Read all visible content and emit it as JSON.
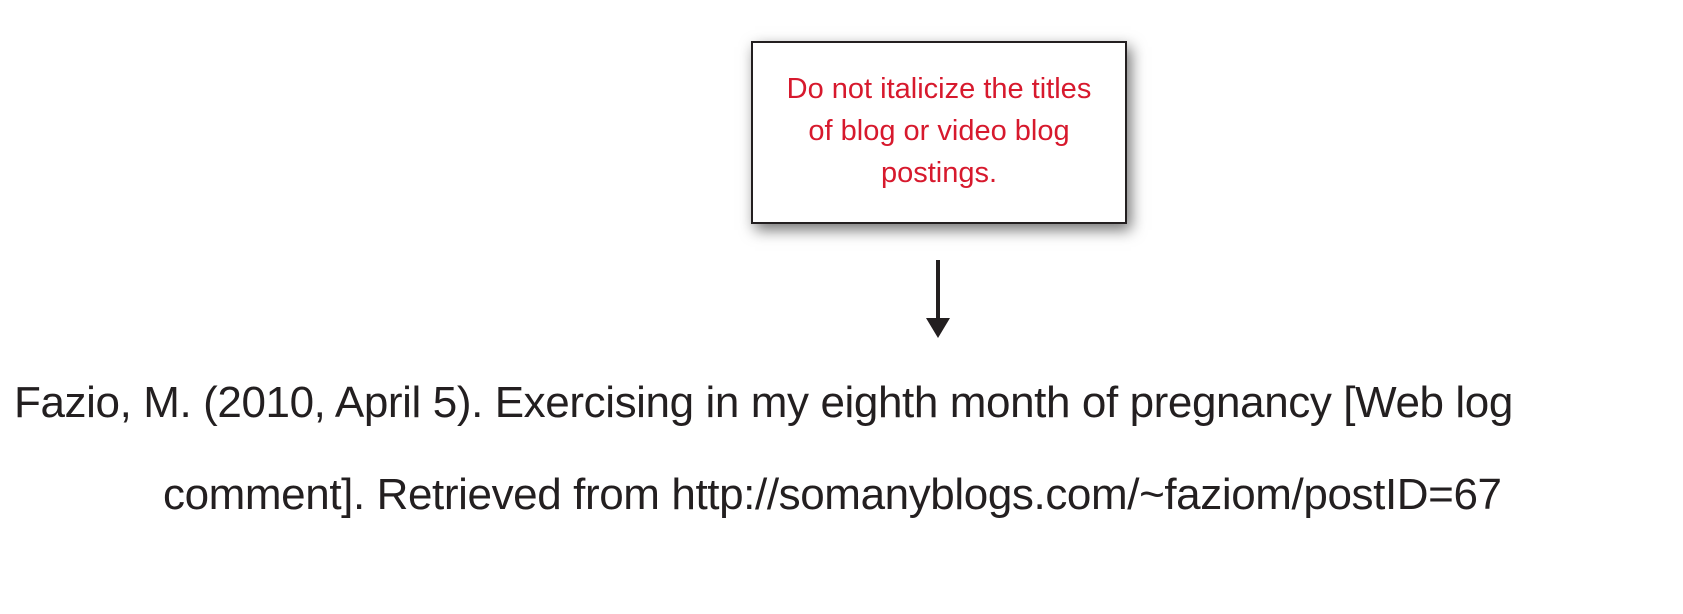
{
  "callout": {
    "text": "Do not italicize the titles of blog or video blog postings.",
    "text_color": "#d7192d"
  },
  "citation": {
    "line1": "Fazio, M. (2010, April 5). Exercising in my eighth month of pregnancy [Web log",
    "line2": "comment]. Retrieved from http://somanyblogs.com/~faziom/postID=67",
    "text_color": "#231f20"
  },
  "arrow": {
    "icon": "arrow-down-icon",
    "color": "#231f20"
  }
}
